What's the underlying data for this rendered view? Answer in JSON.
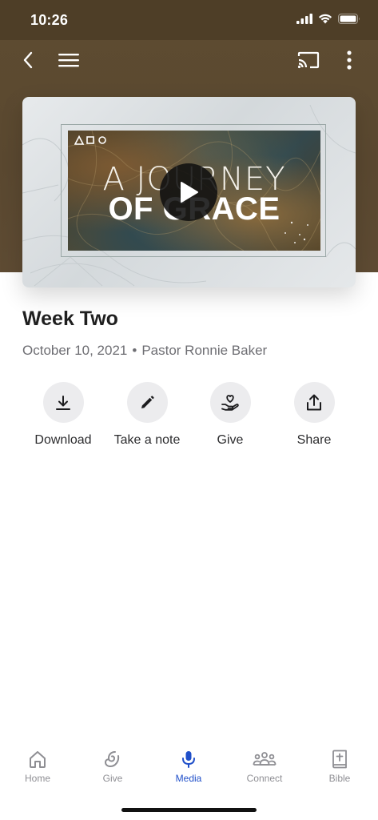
{
  "status_bar": {
    "time": "10:26"
  },
  "nav": {
    "back_icon": "chevron-left-icon",
    "menu_icon": "hamburger-icon",
    "cast_icon": "cast-icon",
    "more_icon": "more-vertical-icon"
  },
  "video": {
    "art_line1": "A JOURNEY",
    "art_line2": "OF GRACE",
    "play_icon": "play-icon"
  },
  "sermon": {
    "title": "Week Two",
    "date": "October 10, 2021",
    "separator": "•",
    "speaker": "Pastor Ronnie Baker"
  },
  "actions": [
    {
      "label": "Download",
      "icon": "download-icon"
    },
    {
      "label": "Take a note",
      "icon": "pencil-icon"
    },
    {
      "label": "Give",
      "icon": "give-heart-hand-icon"
    },
    {
      "label": "Share",
      "icon": "share-icon"
    }
  ],
  "tabs": [
    {
      "label": "Home",
      "icon": "home-icon",
      "active": false
    },
    {
      "label": "Give",
      "icon": "give-icon",
      "active": false
    },
    {
      "label": "Media",
      "icon": "microphone-icon",
      "active": true
    },
    {
      "label": "Connect",
      "icon": "people-icon",
      "active": false
    },
    {
      "label": "Bible",
      "icon": "bible-icon",
      "active": false
    }
  ],
  "colors": {
    "accent": "#1f4fc9",
    "header_brown": "#5a4830",
    "inactive": "#8e8e93"
  }
}
